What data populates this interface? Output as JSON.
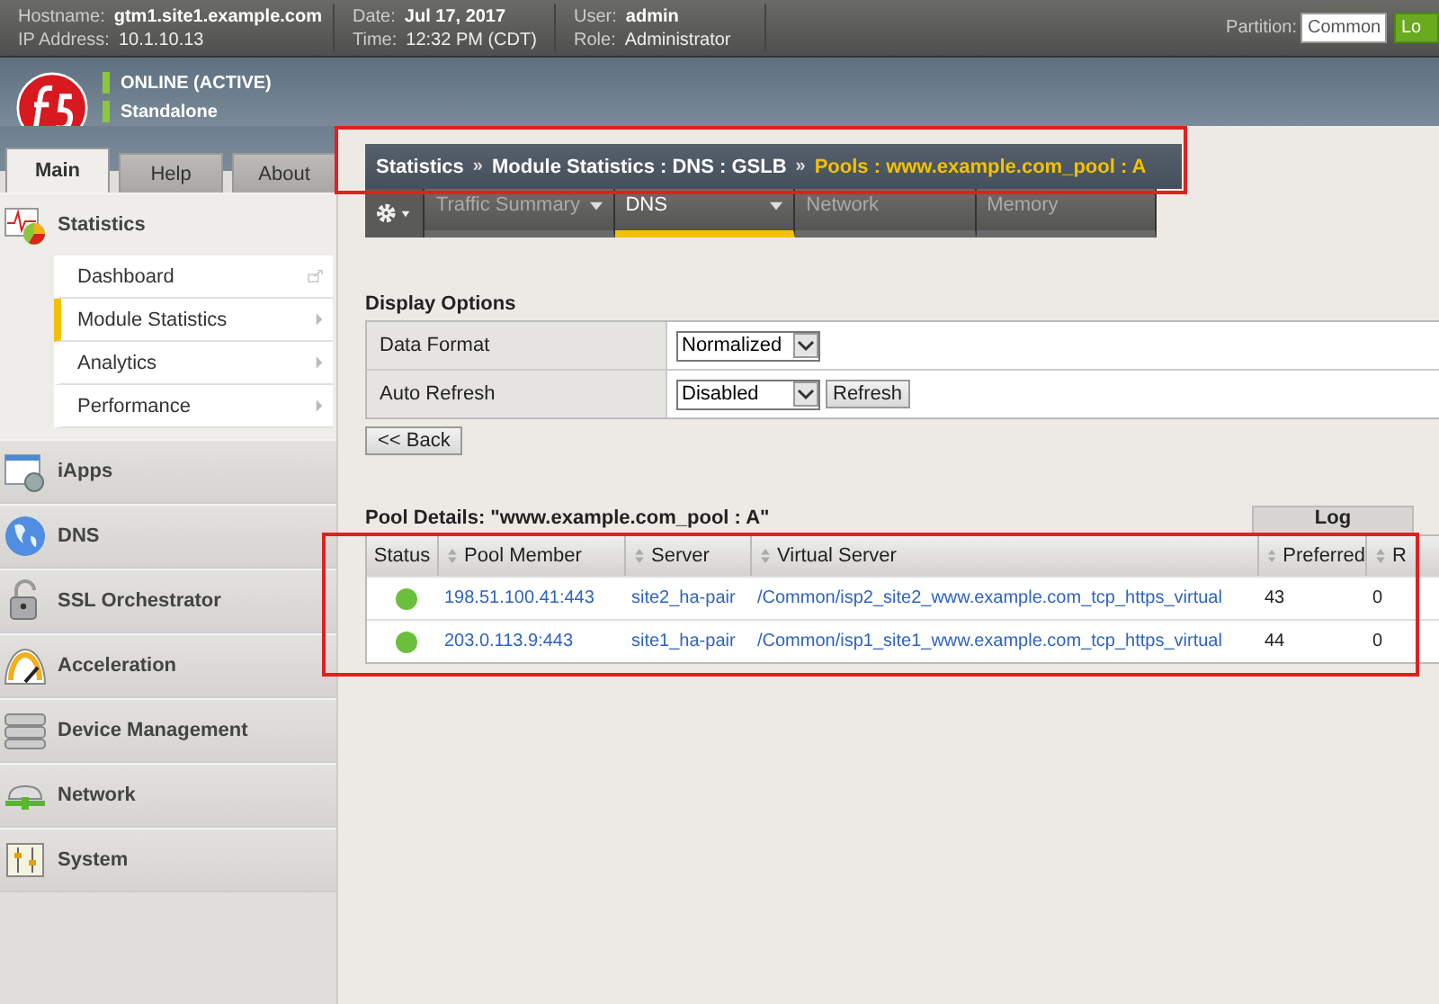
{
  "header": {
    "columns": [
      [
        {
          "label": "Hostname:",
          "value": "gtm1.site1.example.com"
        },
        {
          "label": "IP Address:",
          "value": "10.1.10.13"
        }
      ],
      [
        {
          "label": "Date:",
          "value": "Jul 17, 2017"
        },
        {
          "label": "Time:",
          "value": "12:32 PM (CDT)"
        }
      ],
      [
        {
          "label": "User:",
          "value": "admin"
        },
        {
          "label": "Role:",
          "value": "Administrator"
        }
      ]
    ],
    "partition": {
      "label": "Partition:",
      "value": "Common"
    },
    "logout_button": "Lo"
  },
  "status": [
    "ONLINE (ACTIVE)",
    "Standalone"
  ],
  "sidebar": {
    "tabs": [
      {
        "label": "Main",
        "selected": true
      },
      {
        "label": "Help",
        "selected": false
      },
      {
        "label": "About",
        "selected": false
      }
    ],
    "sections": [
      {
        "label": "Statistics",
        "children": [
          {
            "label": "Dashboard",
            "selected": false,
            "kind": "external"
          },
          {
            "label": "Module Statistics",
            "selected": true,
            "kind": "submenu"
          },
          {
            "label": "Analytics",
            "selected": false,
            "kind": "submenu"
          },
          {
            "label": "Performance",
            "selected": false,
            "kind": "submenu"
          }
        ]
      },
      {
        "label": "iApps"
      },
      {
        "label": "DNS"
      },
      {
        "label": "SSL Orchestrator"
      },
      {
        "label": "Acceleration"
      },
      {
        "label": "Device Management"
      },
      {
        "label": "Network"
      },
      {
        "label": "System"
      }
    ]
  },
  "breadcrumb": [
    {
      "text": "Statistics",
      "kind": "link"
    },
    {
      "text": "»",
      "kind": "separator"
    },
    {
      "text": "Module Statistics : DNS : GSLB",
      "kind": "link"
    },
    {
      "text": "»",
      "kind": "separator"
    },
    {
      "text": "Pools : www.example.com_pool : A",
      "kind": "current"
    }
  ],
  "nav_tabs": [
    {
      "label": "Traffic Summary",
      "selected": false,
      "dropdown": true
    },
    {
      "label": "DNS",
      "selected": true,
      "dropdown": true
    },
    {
      "label": "Network",
      "selected": false,
      "dropdown": false
    },
    {
      "label": "Memory",
      "selected": false,
      "dropdown": false
    }
  ],
  "display_options": {
    "title": "Display Options",
    "rows": [
      {
        "label": "Data Format",
        "value": "Normalized"
      },
      {
        "label": "Auto Refresh",
        "value": "Disabled",
        "button": "Refresh"
      }
    ],
    "back_button": "<< Back"
  },
  "pool_details": {
    "title": "Pool Details: \"www.example.com_pool : A\"",
    "group_header": "Log",
    "columns": [
      {
        "label": "Status",
        "sortable": false
      },
      {
        "label": "Pool Member",
        "sortable": true
      },
      {
        "label": "Server",
        "sortable": true
      },
      {
        "label": "Virtual Server",
        "sortable": true
      },
      {
        "label": "Preferred",
        "sortable": true
      },
      {
        "label": "R",
        "sortable": true
      }
    ],
    "rows": [
      {
        "color": "#6cbf3c",
        "member": "198.51.100.41:443",
        "server": "site2_ha-pair",
        "virtual_server": "/Common/isp2_site2_www.example.com_tcp_https_virtual",
        "preferred": "43",
        "column_6": "0"
      },
      {
        "color": "#6cbf3c",
        "member": "203.0.113.9:443",
        "server": "site1_ha-pair",
        "virtual_server": "/Common/isp1_site1_www.example.com_tcp_https_virtual",
        "preferred": "44",
        "column_6": "0"
      }
    ]
  }
}
